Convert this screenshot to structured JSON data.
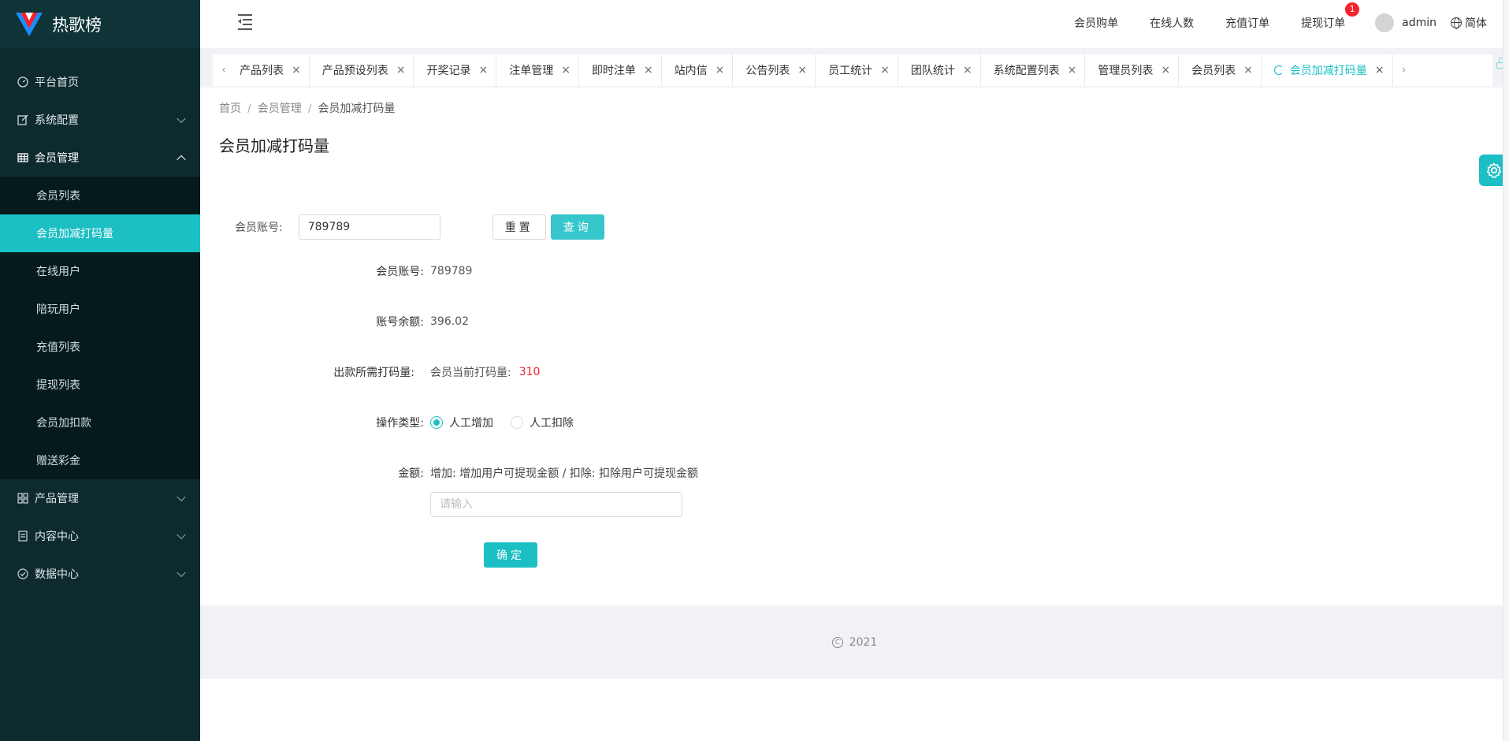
{
  "app": {
    "title": "热歌榜"
  },
  "sidebar": {
    "items": [
      {
        "label": "平台首页",
        "icon": "dashboard-icon"
      },
      {
        "label": "系统配置",
        "icon": "edit-icon"
      },
      {
        "label": "会员管理",
        "icon": "table-icon"
      },
      {
        "label": "产品管理",
        "icon": "grid-icon"
      },
      {
        "label": "内容中心",
        "icon": "document-icon"
      },
      {
        "label": "数据中心",
        "icon": "check-circle-icon"
      }
    ],
    "member_submenu": [
      "会员列表",
      "会员加减打码量",
      "在线用户",
      "陪玩用户",
      "充值列表",
      "提现列表",
      "会员加扣款",
      "赠送彩金"
    ]
  },
  "header": {
    "links": [
      "会员购单",
      "在线人数",
      "充值订单",
      "提现订单"
    ],
    "withdraw_badge": "1",
    "user": "admin",
    "language": "简体"
  },
  "tabs": [
    "产品列表",
    "产品预设列表",
    "开奖记录",
    "注单管理",
    "即时注单",
    "站内信",
    "公告列表",
    "员工统计",
    "团队统计",
    "系统配置列表",
    "管理员列表",
    "会员列表",
    "会员加减打码量"
  ],
  "breadcrumb": [
    "首页",
    "会员管理",
    "会员加减打码量"
  ],
  "page_title": "会员加减打码量",
  "search": {
    "label": "会员账号:",
    "value": "789789",
    "reset_label": "重置",
    "query_label": "查询"
  },
  "form": {
    "account_label": "会员账号:",
    "account_value": "789789",
    "balance_label": "账号余额:",
    "balance_value": "396.02",
    "required_label": "出款所需打码量:",
    "current_label": "会员当前打码量:",
    "current_value": "310",
    "op_type_label": "操作类型:",
    "op_add": "人工增加",
    "op_deduct": "人工扣除",
    "amount_label": "金额:",
    "amount_hint": "增加: 增加用户可提现金额 / 扣除: 扣除用户可提现金额",
    "amount_placeholder": "请输入",
    "confirm_label": "确定"
  },
  "footer": {
    "year": "2021"
  },
  "colors": {
    "accent": "#1bbfc4",
    "sidebar_bg": "#0d2b2f",
    "danger": "#f5222d"
  }
}
